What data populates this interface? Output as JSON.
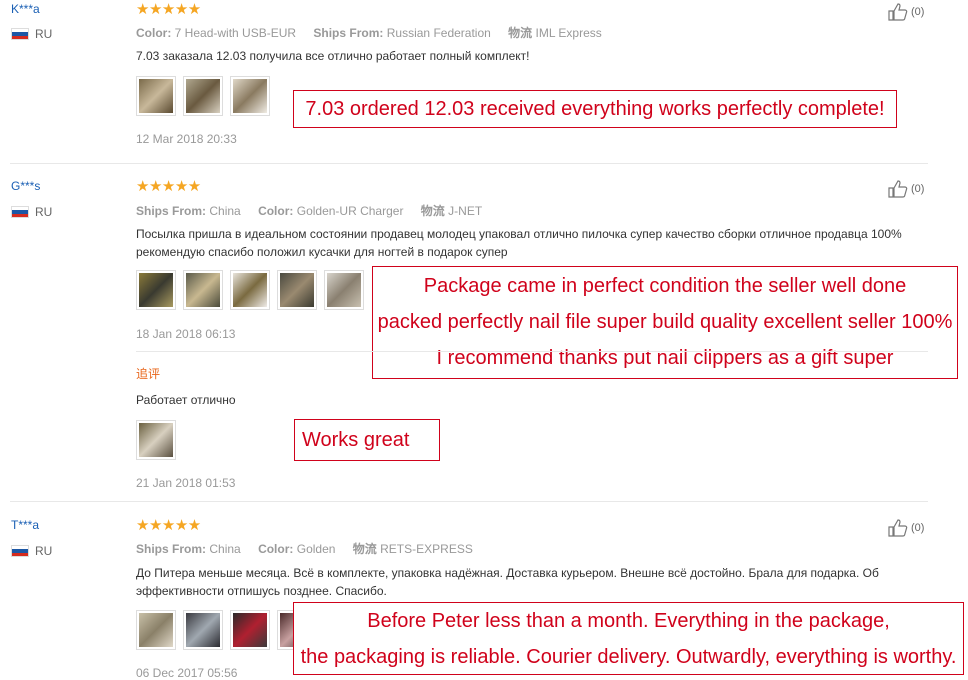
{
  "colors": {
    "star": "#f5a623",
    "callout": "#d0021b",
    "username": "#1a5fb4",
    "additional": "#e8651a"
  },
  "icons": {
    "star": "★",
    "like": "thumbs-up-icon"
  },
  "reviews": [
    {
      "username": "K***a",
      "country": "RU",
      "stars": "★★★★★",
      "meta": [
        {
          "label": "Color:",
          "value": "7 Head-with USB-EUR"
        },
        {
          "label": "Ships From:",
          "value": "Russian Federation"
        },
        {
          "label": "物流",
          "value": "IML Express"
        }
      ],
      "text": "7.03 заказала 12.03 получила все отлично работает полный комплект!",
      "date": "12 Mar 2018 20:33",
      "likes": "(0)",
      "translation": [
        "7.03 ordered 12.03 received everything works perfectly complete!"
      ]
    },
    {
      "username": "G***s",
      "country": "RU",
      "stars": "★★★★★",
      "meta": [
        {
          "label": "Ships From:",
          "value": "China"
        },
        {
          "label": "Color:",
          "value": "Golden-UR Charger"
        },
        {
          "label": "物流",
          "value": "J-NET"
        }
      ],
      "text": "Посылка пришла в идеальном состоянии продавец молодец упаковал отлично пилочка супер качество сборки отличное продавца 100% рекомендую спасибо положил кусачки для ногтей в подарок супер",
      "date": "18 Jan 2018 06:13",
      "likes": "(0)",
      "translation": [
        "Package came in perfect condition the seller well done",
        "packed perfectly nail file super build quality excellent seller 100%",
        "I recommend thanks put nail clippers as a gift super"
      ],
      "additional": {
        "label": "追评",
        "text": "Работает отлично",
        "date": "21 Jan 2018 01:53",
        "translation": [
          "Works great"
        ]
      }
    },
    {
      "username": "T***a",
      "country": "RU",
      "stars": "★★★★★",
      "meta": [
        {
          "label": "Ships From:",
          "value": "China"
        },
        {
          "label": "Color:",
          "value": "Golden"
        },
        {
          "label": "物流",
          "value": "RETS-EXPRESS"
        }
      ],
      "text": "До Питера меньше месяца. Всё в комплекте, упаковка надёжная. Доставка курьером. Внешне всё достойно. Брала для подарка. Об эффективности отпишусь позднее. Спасибо.",
      "date": "06 Dec 2017 05:56",
      "likes": "(0)",
      "translation": [
        "Before Peter less than a month. Everything in the package,",
        "the packaging is reliable. Courier delivery. Outwardly, everything is worthy."
      ]
    }
  ]
}
